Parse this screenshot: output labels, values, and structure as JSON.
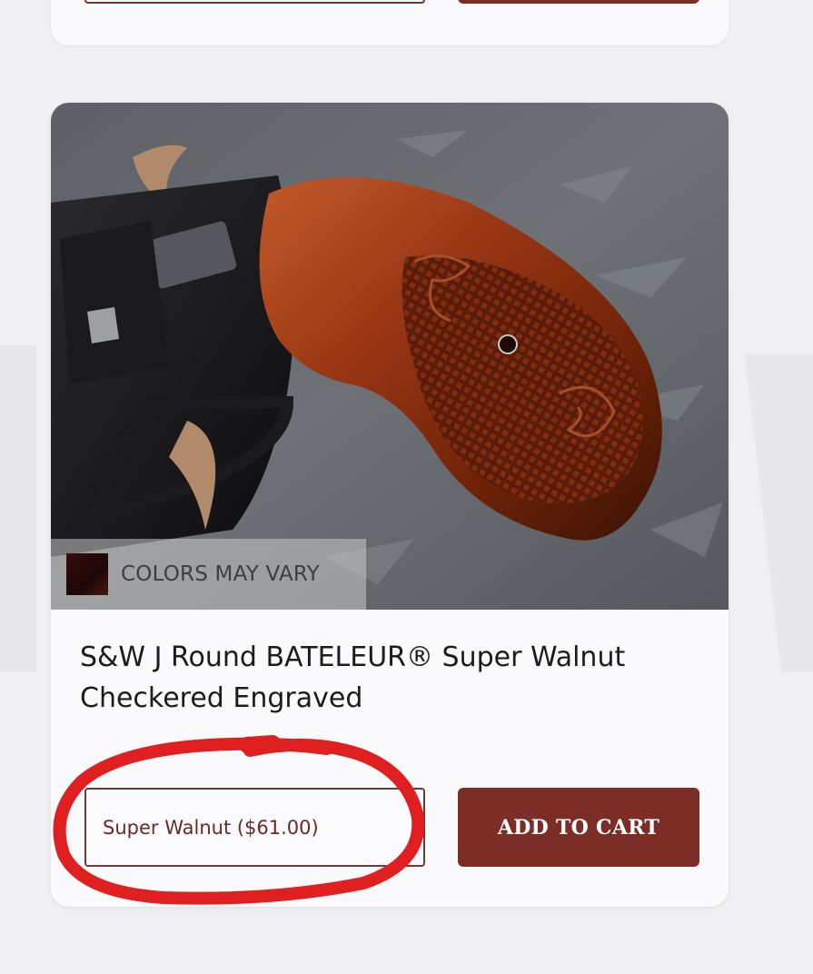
{
  "product": {
    "badge_text": "COLORS MAY VARY",
    "title": "S&W J Round BATELEUR® Super Walnut Checkered Engraved",
    "selected_variant": "Super Walnut ($61.00)",
    "add_to_cart_label": "ADD TO CART"
  },
  "colors": {
    "page_background": "#f0f0f2",
    "card_background": "#fafafc",
    "accent": "#7c2e26",
    "select_border": "#6a3a34",
    "annotation_circle": "#e02020"
  },
  "icons": {
    "swatch": "color-swatch",
    "annotation": "red-circle-annotation"
  }
}
